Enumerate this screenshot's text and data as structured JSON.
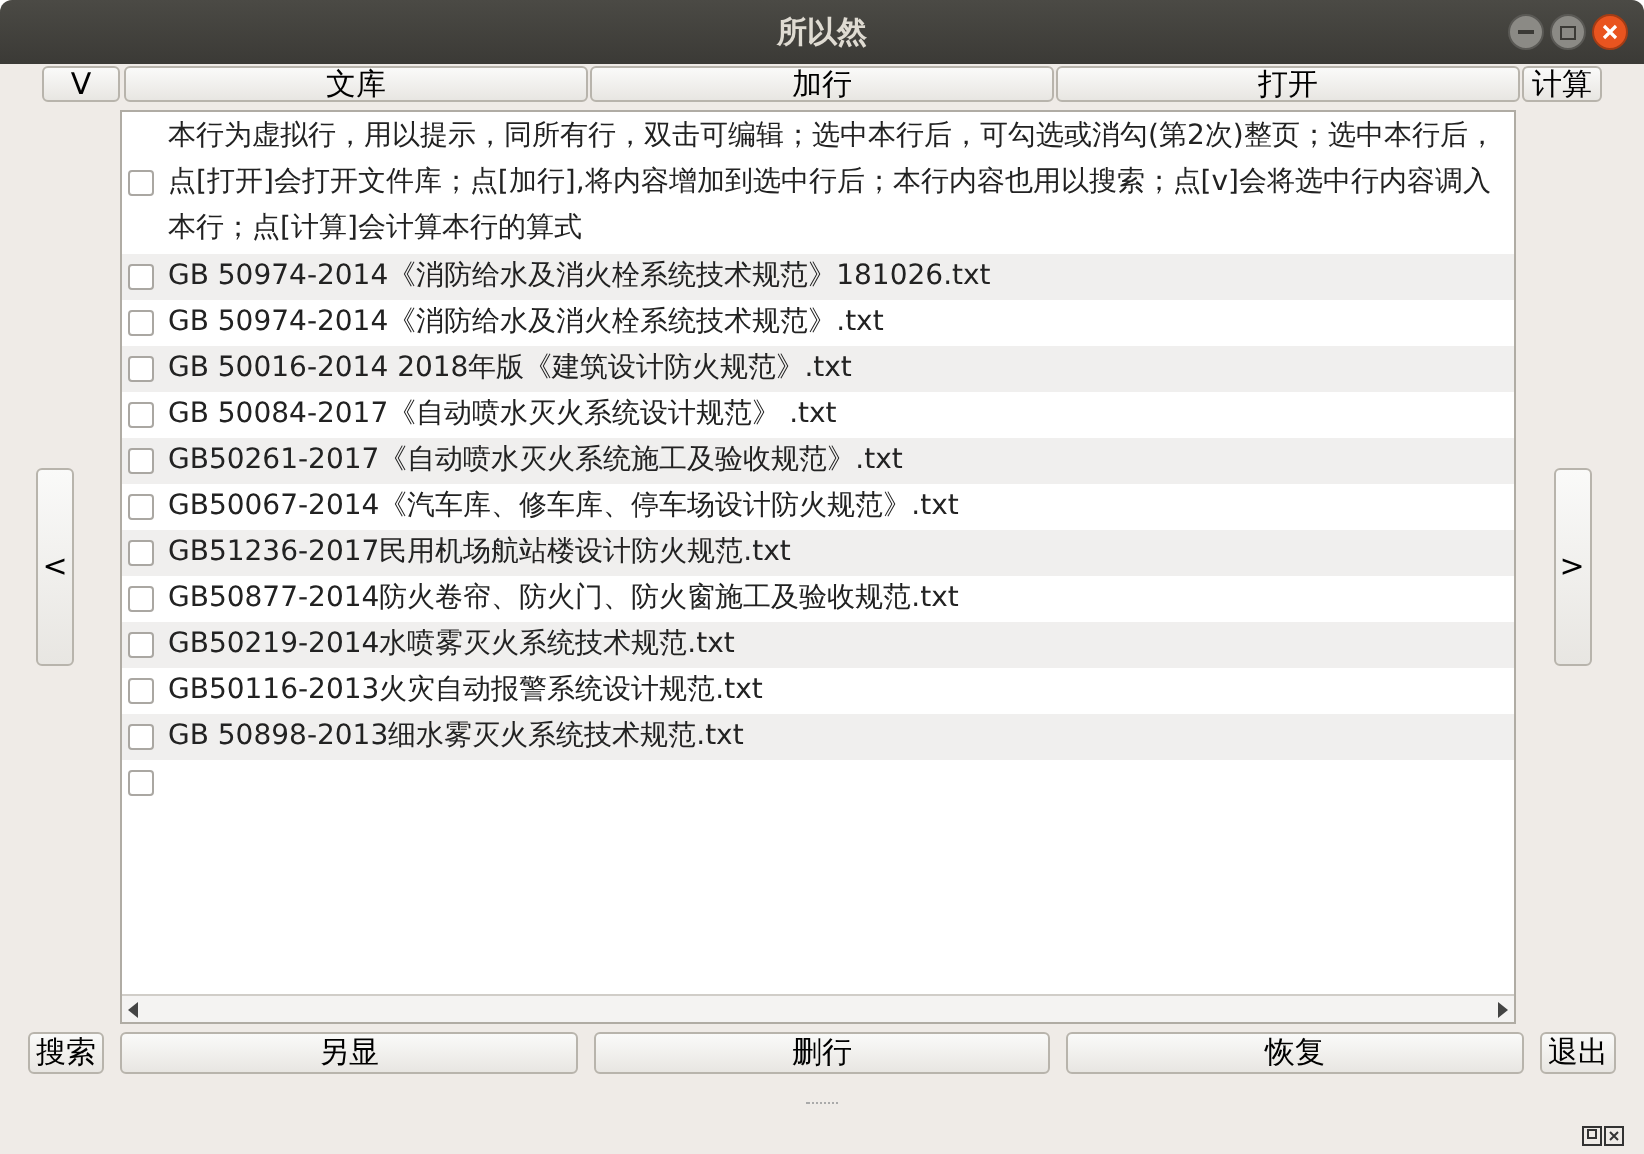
{
  "window": {
    "title": "所以然"
  },
  "top_buttons": [
    "V",
    "文库",
    "加行",
    "打开",
    "计算"
  ],
  "rows": [
    {
      "text": "本行为虚拟行，用以提示，同所有行，双击可编辑；选中本行后，可勾选或消勾(第2次)整页；选中本行后，点[打开]会打开文件库；点[加行],将内容增加到选中行后；本行内容也用以搜索；点[v]会将选中行内容调入本行；点[计算]会计算本行的算式",
      "checked": false
    },
    {
      "text": "GB 50974-2014《消防给水及消火栓系统技术规范》181026.txt",
      "checked": false
    },
    {
      "text": "GB 50974-2014《消防给水及消火栓系统技术规范》.txt",
      "checked": false
    },
    {
      "text": "GB 50016-2014  2018年版《建筑设计防火规范》.txt",
      "checked": false
    },
    {
      "text": "GB 50084-2017《自动喷水灭火系统设计规范》 .txt",
      "checked": false
    },
    {
      "text": "GB50261-2017《自动喷水灭火系统施工及验收规范》.txt",
      "checked": false
    },
    {
      "text": "GB50067-2014《汽车库、修车库、停车场设计防火规范》.txt",
      "checked": false
    },
    {
      "text": "GB51236-2017民用机场航站楼设计防火规范.txt",
      "checked": false
    },
    {
      "text": "GB50877-2014防火卷帘、防火门、防火窗施工及验收规范.txt",
      "checked": false
    },
    {
      "text": "GB50219-2014水喷雾灭火系统技术规范.txt",
      "checked": false
    },
    {
      "text": "GB50116-2013火灾自动报警系统设计规范.txt",
      "checked": false
    },
    {
      "text": "GB 50898-2013细水雾灭火系统技术规范.txt",
      "checked": false
    },
    {
      "checked": false
    }
  ],
  "prev_button": "<",
  "next_button": ">",
  "bottom_buttons": [
    "搜索",
    "另显",
    "删行",
    "恢复",
    "退出"
  ]
}
